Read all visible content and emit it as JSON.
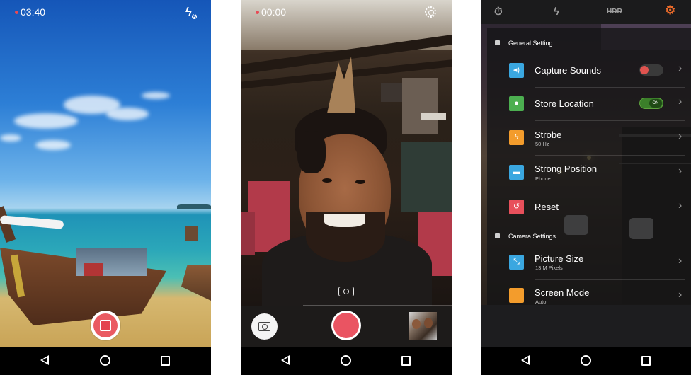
{
  "screen1": {
    "timer": "03:40",
    "flash_icon": "flash-auto-icon",
    "stop_button": "stop-record"
  },
  "screen2": {
    "timer": "00:00",
    "settings_icon": "gear-icon",
    "switch_camera_icon": "camera-switch-icon",
    "snapshot_icon": "camera-icon",
    "record_button": "record",
    "gallery_thumbnail": "gallery-thumbnail"
  },
  "screen3": {
    "tabs": [
      {
        "icon": "timer-icon",
        "glyph": "⏱"
      },
      {
        "icon": "flash-auto-icon",
        "glyph": "ϟ"
      },
      {
        "icon": "hdr-off-icon",
        "glyph": "HDR"
      },
      {
        "icon": "gear-icon",
        "glyph": "⚙",
        "active": true
      }
    ],
    "section_general": "General Setting",
    "section_camera": "Camera Settings",
    "rows": [
      {
        "title": "Capture Sounds",
        "subtitle": "",
        "icon": "speaker-icon",
        "glyph": "◂)",
        "color": "#3aa7e0",
        "toggle": "off"
      },
      {
        "title": "Store Location",
        "subtitle": "",
        "icon": "location-pin-icon",
        "glyph": "●",
        "color": "#4caf50",
        "toggle": "on",
        "toggle_label": "ON"
      },
      {
        "title": "Strobe",
        "subtitle": "50 Hz",
        "icon": "flash-icon",
        "glyph": "ϟ",
        "color": "#f39c2c"
      },
      {
        "title": "Strong Position",
        "subtitle": "Phone",
        "icon": "folder-icon",
        "glyph": "▬",
        "color": "#3aa7e0"
      },
      {
        "title": "Reset",
        "subtitle": "",
        "icon": "reset-icon",
        "glyph": "↺",
        "color": "#e8505b"
      },
      {
        "title": "Picture Size",
        "subtitle": "13 M Pixels",
        "icon": "resize-icon",
        "glyph": "⤡",
        "color": "#3aa7e0"
      },
      {
        "title": "Screen Mode",
        "subtitle": "Auto",
        "icon": "screen-icon",
        "glyph": "",
        "color": "#f39c2c"
      }
    ]
  },
  "navbar": {
    "back_icon": "back-icon",
    "home_icon": "home-icon",
    "recents_icon": "recents-icon"
  },
  "colors": {
    "accent_red": "#ea5462",
    "accent_orange": "#ef6c2a",
    "toggle_on_green": "#3b7f2a"
  }
}
